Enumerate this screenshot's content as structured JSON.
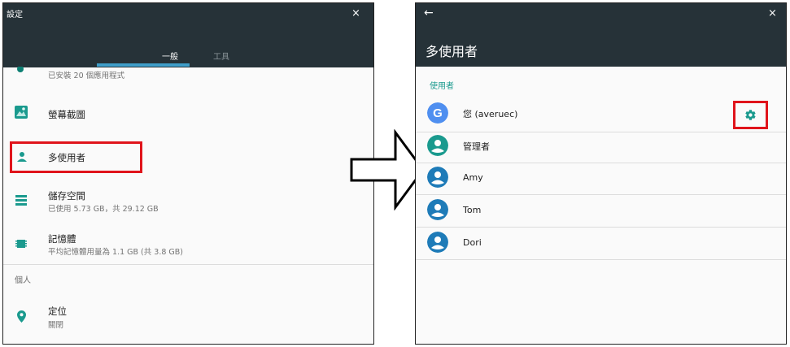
{
  "left": {
    "title": "設定",
    "close": "×",
    "tabs": [
      "一般",
      "工具"
    ],
    "rows": [
      {
        "sub": "已安裝 20 個應用程式"
      },
      {
        "title": "螢幕截圖"
      },
      {
        "title": "多使用者"
      },
      {
        "title": "儲存空間",
        "sub": "已使用 5.73 GB，共 29.12 GB"
      },
      {
        "title": "記憶體",
        "sub": "平均記憶體用量為 1.1 GB (共 3.8 GB)"
      }
    ],
    "section": "個人",
    "location": {
      "title": "定位",
      "sub": "關閉"
    }
  },
  "right": {
    "back": "←",
    "close": "×",
    "title": "多使用者",
    "subheader": "使用者",
    "users": [
      {
        "name": "您 (averuec)"
      },
      {
        "name": "管理者"
      },
      {
        "name": "Amy"
      },
      {
        "name": "Tom"
      },
      {
        "name": "Dori"
      }
    ]
  },
  "colors": {
    "header": "#263238",
    "accent_teal": "#1a9a8e",
    "highlight_red": "#e0141b",
    "google_blue": "#4f8ff0"
  }
}
